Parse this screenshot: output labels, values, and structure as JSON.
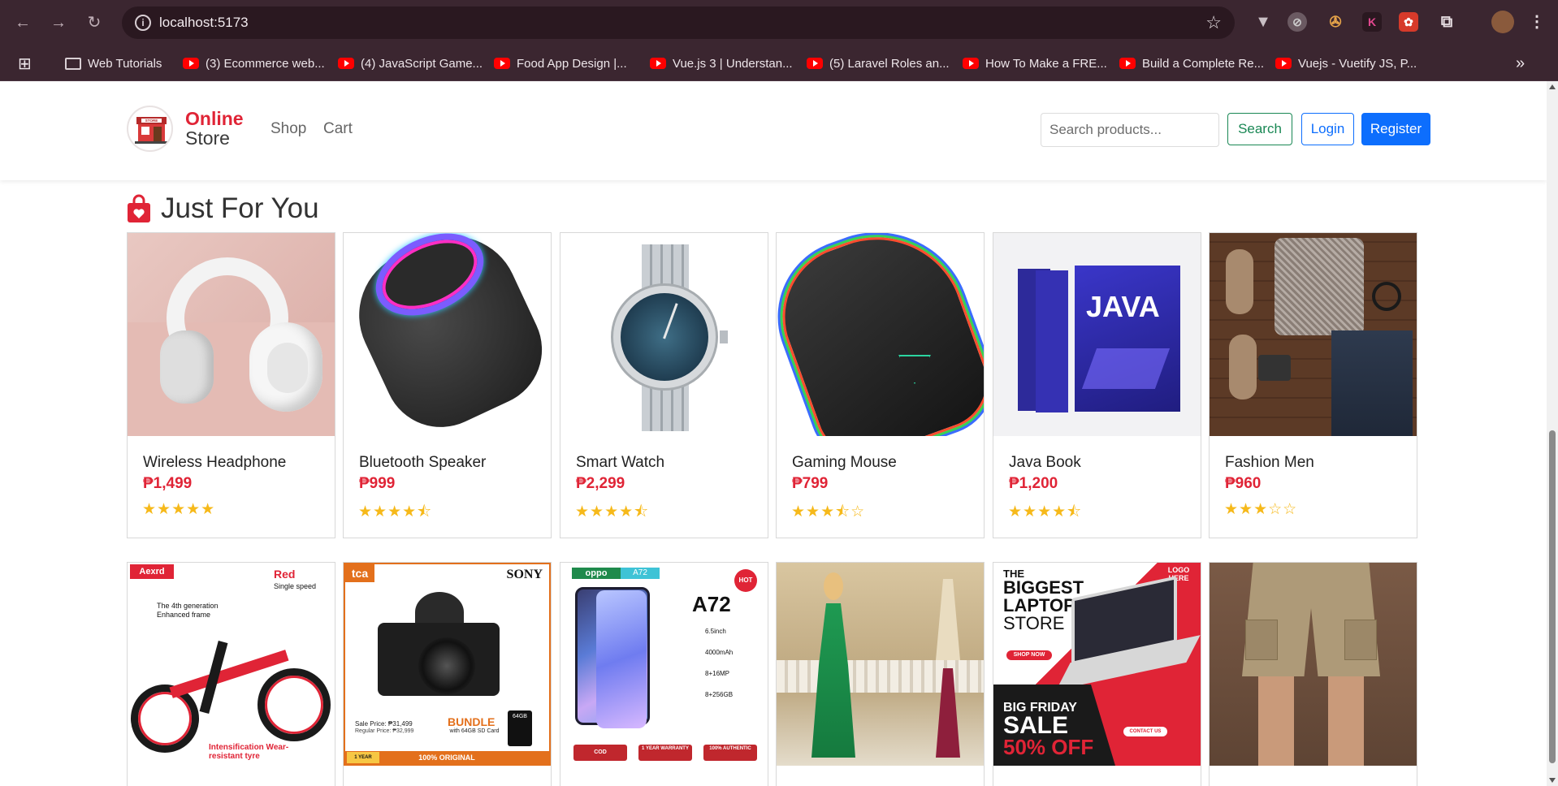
{
  "browser": {
    "url": "localhost:5173",
    "bookmarks": [
      {
        "label": "Web Tutorials",
        "type": "folder"
      },
      {
        "label": "(3) Ecommerce web...",
        "type": "youtube"
      },
      {
        "label": "(4) JavaScript Game...",
        "type": "youtube"
      },
      {
        "label": "Food App Design |...",
        "type": "youtube"
      },
      {
        "label": "Vue.js 3 | Understan...",
        "type": "youtube"
      },
      {
        "label": "(5) Laravel Roles an...",
        "type": "youtube"
      },
      {
        "label": "How To Make a FRE...",
        "type": "youtube"
      },
      {
        "label": "Build a Complete Re...",
        "type": "youtube"
      },
      {
        "label": "Vuejs - Vuetify JS, P...",
        "type": "youtube"
      }
    ]
  },
  "header": {
    "logo_line1": "Online",
    "logo_line2": "Store",
    "logo_badge_text": "STORE",
    "nav": [
      "Shop",
      "Cart"
    ],
    "search_placeholder": "Search products...",
    "search_label": "Search",
    "login_label": "Login",
    "register_label": "Register"
  },
  "section": {
    "title": "Just For You"
  },
  "colors": {
    "brand_red": "#e02436",
    "star_gold": "#f6b91a",
    "primary_blue": "#0d6efd",
    "success_green": "#198754"
  },
  "products_row1": [
    {
      "name": "Wireless Headphone",
      "price": "₱1,499",
      "stars": "★★★★★",
      "rating": 5
    },
    {
      "name": "Bluetooth Speaker",
      "price": "₱999",
      "stars": "★★★★⯪",
      "rating": 4.5
    },
    {
      "name": "Smart Watch",
      "price": "₱2,299",
      "stars": "★★★★⯪",
      "rating": 4.5
    },
    {
      "name": "Gaming Mouse",
      "price": "₱799",
      "stars": "★★★⯪☆",
      "rating": 3.5
    },
    {
      "name": "Java Book",
      "price": "₱1,200",
      "stars": "★★★★⯪",
      "rating": 4.5
    },
    {
      "name": "Fashion Men",
      "price": "₱960",
      "stars": "★★★☆☆",
      "rating": 3
    }
  ],
  "products_row2_image_text": {
    "bike": {
      "brand": "Aexrd",
      "color": "Red",
      "speed": "Single speed",
      "frame": "The 4th generation Enhanced frame",
      "tyre": "Intensification Wear-resistant tyre"
    },
    "camera": {
      "shop": "tca",
      "brand": "SONY",
      "sale": "Sale Price: ₱31,499",
      "regular": "Regular Price: ₱32,999",
      "bundle": "BUNDLE",
      "bundle_with": "with 64GB SD Card",
      "sd": "64GB",
      "banner": "100% ORIGINAL",
      "warranty": "1 YEAR"
    },
    "phone": {
      "brand": "oppo",
      "model_tag": "A72",
      "model": "A72",
      "hot": "HOT",
      "specs": [
        "6.5inch",
        "4000mAh",
        "8+16MP",
        "8+256GB"
      ],
      "badges": [
        "COD",
        "1 YEAR WARRANTY",
        "100% AUTHENTIC"
      ]
    },
    "laptop": {
      "line1": "THE",
      "line2": "BIGGEST",
      "line3": "LAPTOP",
      "line4": "STORE",
      "logo": "LOGO HERE",
      "cta": "SHOP NOW",
      "sale1": "BIG FRIDAY",
      "sale2": "SALE",
      "sale3": "50% OFF",
      "contact": "CONTACT US"
    }
  }
}
